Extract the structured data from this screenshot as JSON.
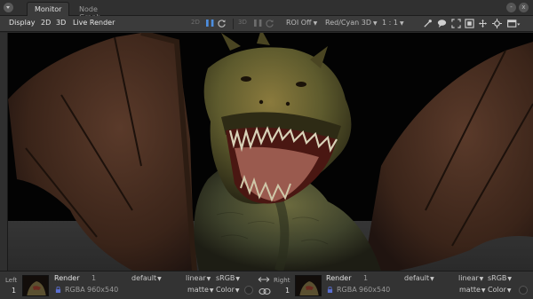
{
  "tabs": [
    {
      "label": "Monitor",
      "active": true
    },
    {
      "label": "Node Graph",
      "active": false
    }
  ],
  "window_buttons": [
    "-",
    "x"
  ],
  "toolbar": {
    "display": "Display",
    "mode_2d": "2D",
    "mode_3d": "3D",
    "live_render": "Live Render",
    "left_2d": "2D",
    "left_3d": "3D",
    "roi": "ROI Off",
    "stereo": "Red/Cyan 3D",
    "zoom": "1 : 1"
  },
  "viewer": {
    "image": "dragon-render"
  },
  "bottom": {
    "left": {
      "side": "Left",
      "index": "1",
      "name": "Render",
      "frame": "1",
      "preset": "default",
      "format": "RGBA",
      "resolution": "960x540",
      "colorspace": "linear",
      "display": "sRGB",
      "mode": "matte",
      "channel": "Color"
    },
    "right": {
      "side": "Right",
      "index": "1",
      "name": "Render",
      "frame": "1",
      "preset": "default",
      "format": "RGBA",
      "resolution": "960x540",
      "colorspace": "linear",
      "display": "sRGB",
      "mode": "matte",
      "channel": "Color"
    }
  },
  "colors": {
    "accent": "#4d8fe0",
    "background": "#2a2a2a",
    "toolbar": "#3b3b3b"
  }
}
